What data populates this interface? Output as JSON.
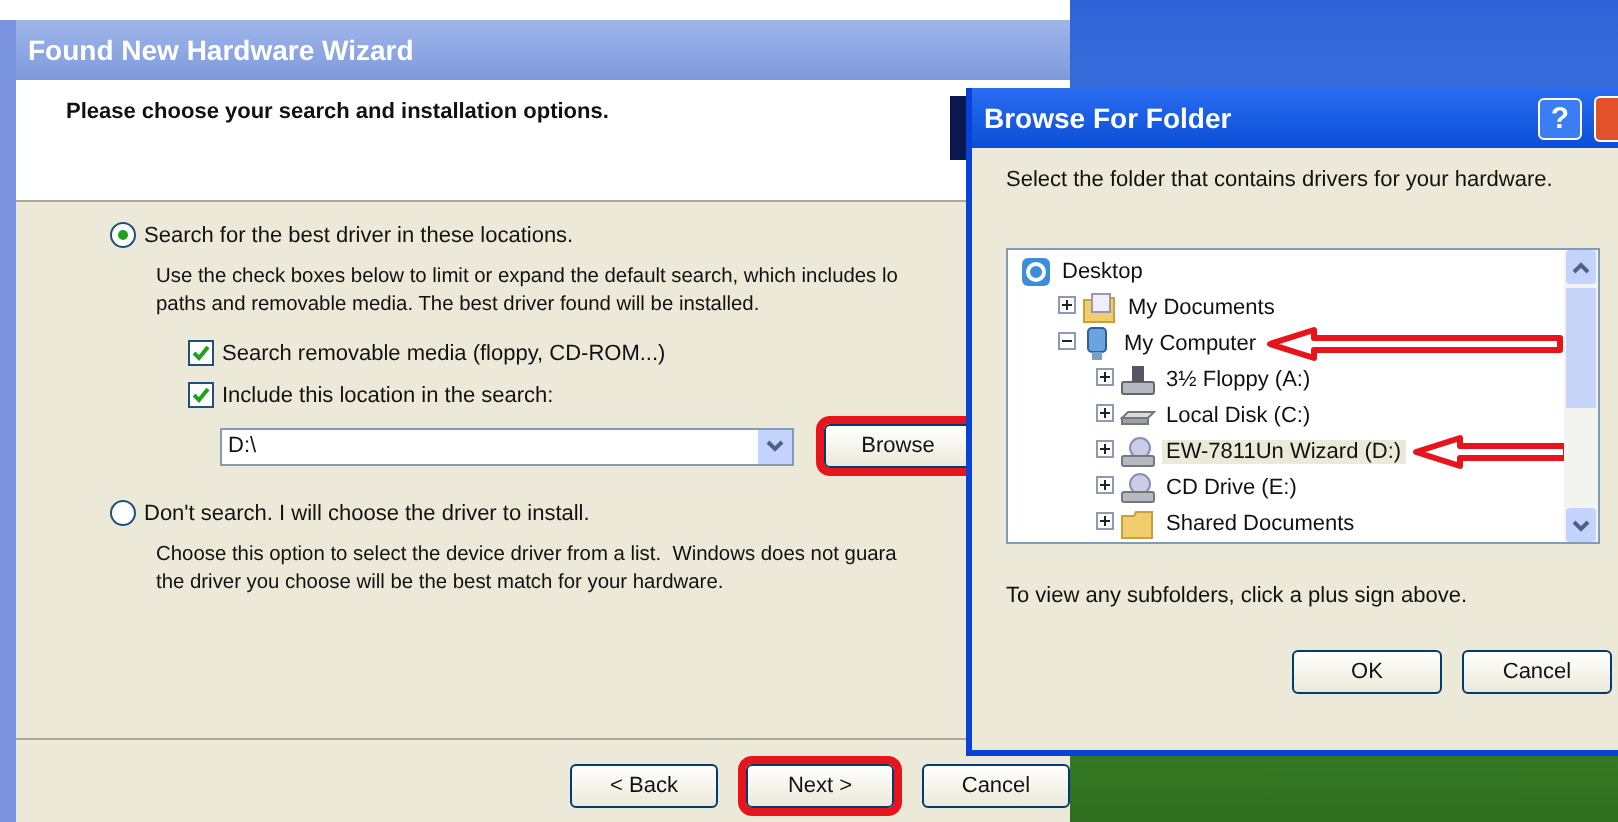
{
  "wizard": {
    "title": "Found New Hardware Wizard",
    "heading": "Please choose your search and installation options.",
    "options": [
      {
        "label": "Search for the best driver in these locations.",
        "selected": true,
        "description": "Use the check boxes below to limit or expand the default search, which includes lo\npaths and removable media. The best driver found will be installed.",
        "checkboxes": [
          {
            "label": "Search removable media (floppy, CD-ROM...)",
            "checked": true
          },
          {
            "label": "Include this location in the search:",
            "checked": true
          }
        ],
        "location": {
          "value": "D:\\",
          "browse": {
            "label": "Browse",
            "highlighted": true
          }
        }
      },
      {
        "label": "Don't search. I will choose the driver to install.",
        "selected": false,
        "description": "Choose this option to select the device driver from a list.  Windows does not guara\nthe driver you choose will be the best match for your hardware."
      }
    ],
    "buttons": [
      {
        "label": "< Back",
        "highlighted": false
      },
      {
        "label": "Next >",
        "highlighted": true
      },
      {
        "label": "Cancel",
        "highlighted": false
      }
    ]
  },
  "dialog": {
    "title": "Browse For Folder",
    "help": "?",
    "prompt": "Select the folder that contains drivers for your hardware.",
    "tree": [
      {
        "label": "Desktop",
        "kind": "desktop",
        "selected": false,
        "marked": false,
        "children": [
          {
            "label": "My Documents",
            "kind": "documents",
            "expanded": false,
            "selected": false,
            "marked": false
          },
          {
            "label": "My Computer",
            "kind": "computer",
            "expanded": true,
            "selected": false,
            "marked": true,
            "children": [
              {
                "label": "3½ Floppy (A:)",
                "kind": "floppy",
                "expanded": false,
                "selected": false,
                "marked": false
              },
              {
                "label": "Local Disk (C:)",
                "kind": "disk",
                "expanded": false,
                "selected": false,
                "marked": false
              },
              {
                "label": "EW-7811Un Wizard (D:)",
                "kind": "cd",
                "expanded": false,
                "selected": true,
                "marked": true
              },
              {
                "label": "CD Drive (E:)",
                "kind": "cd",
                "expanded": false,
                "selected": false,
                "marked": false
              },
              {
                "label": "Shared Documents",
                "kind": "folder",
                "expanded": false,
                "selected": false,
                "marked": false
              }
            ]
          }
        ]
      }
    ],
    "hint": "To view any subfolders, click a plus sign above.",
    "buttons": [
      {
        "label": "OK"
      },
      {
        "label": "Cancel"
      }
    ]
  }
}
